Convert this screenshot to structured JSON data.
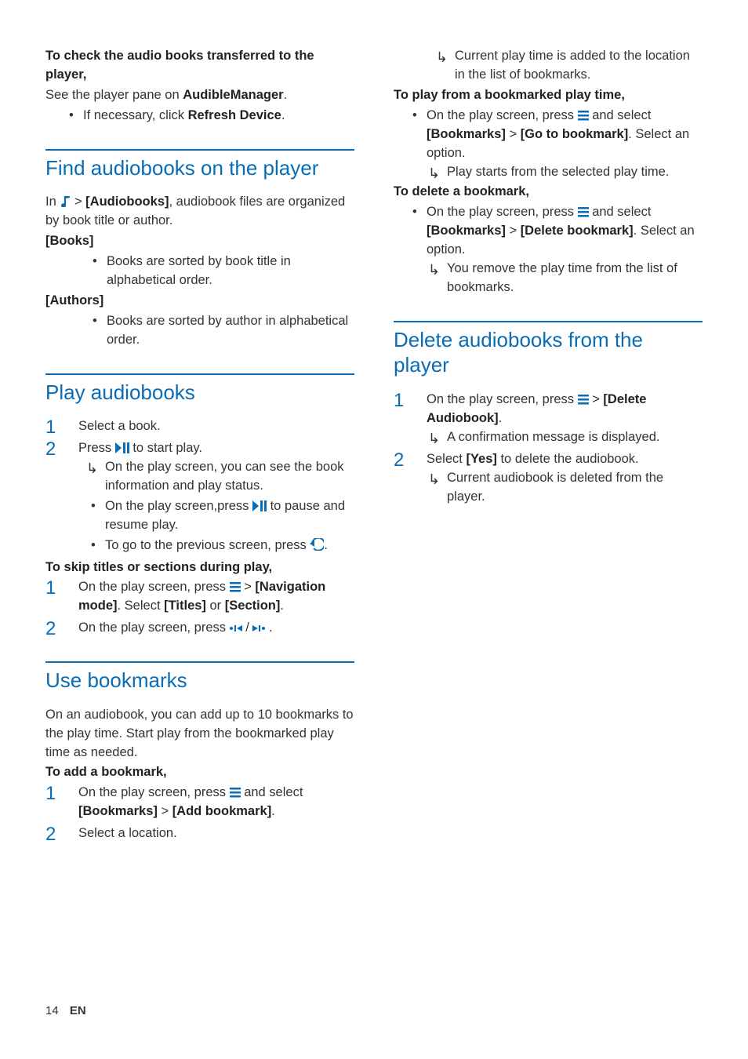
{
  "col1": {
    "check": {
      "heading": "To check the audio books transferred to the player,",
      "line1a": "See the player pane on ",
      "line1b": "AudibleManager",
      "line1c": ".",
      "bullet_a": "If necessary, click ",
      "bullet_b": "Refresh Device",
      "bullet_c": "."
    },
    "find": {
      "title": "Find audiobooks on the player",
      "in_a": "In ",
      "in_b": " > ",
      "in_c": "[Audiobooks]",
      "in_d": ", audiobook files are organized by book title or author.",
      "books_label": "[Books]",
      "books_desc": "Books are sorted by book title in alphabetical order.",
      "authors_label": "[Authors]",
      "authors_desc": "Books are sorted by author in alphabetical order."
    },
    "play": {
      "title": "Play audiobooks",
      "step1": "Select a book.",
      "step2a": "Press ",
      "step2b": " to start play.",
      "step2_arrow": "On the play screen, you can see the book information and play status.",
      "step2_b1a": "On the play screen,press ",
      "step2_b1b": " to pause and resume play.",
      "step2_b2a": "To go to the previous screen, press ",
      "step2_b2b": ".",
      "skip_heading": "To skip titles or sections during play,",
      "skip1a": "On the play screen, press ",
      "skip1b": " > ",
      "skip1c": "[Navigation mode]",
      "skip1d": ". Select ",
      "skip1e": "[Titles]",
      "skip1f": " or ",
      "skip1g": "[Section]",
      "skip1h": ".",
      "skip2a": "On the play screen, press ",
      "skip2b": " / ",
      "skip2c": " ."
    },
    "usebm": {
      "title": "Use bookmarks",
      "intro": "On an audiobook, you can add up to 10 bookmarks to the play time. Start play from the bookmarked play time as needed.",
      "add_heading": "To add a bookmark,",
      "add1a": "On the play screen, press ",
      "add1b": " and select ",
      "add1c": "[Bookmarks]",
      "add1d": " > ",
      "add1e": "[Add bookmark]",
      "add1f": ".",
      "add2": "Select a location."
    }
  },
  "col2": {
    "top_arrow": "Current play time is added to the location in the list of bookmarks.",
    "playfrom_heading": "To play from a bookmarked play time,",
    "playfrom_b_a": "On the play screen, press ",
    "playfrom_b_b": " and select ",
    "playfrom_b_c": "[Bookmarks]",
    "playfrom_b_d": " > ",
    "playfrom_b_e": "[Go to bookmark]",
    "playfrom_b_f": ". Select an option.",
    "playfrom_arrow": "Play starts from the selected play time.",
    "delete_heading": "To delete a bookmark,",
    "delete_b_a": "On the play screen, press ",
    "delete_b_b": " and select ",
    "delete_b_c": "[Bookmarks]",
    "delete_b_d": " > ",
    "delete_b_e": "[Delete bookmark]",
    "delete_b_f": ". Select an option.",
    "delete_arrow": "You remove the play time from the list of bookmarks.",
    "delbooks": {
      "title": "Delete audiobooks from the player",
      "s1a": "On the play screen, press ",
      "s1b": " > ",
      "s1c": "[Delete Audiobook]",
      "s1d": ".",
      "s1_arrow": "A confirmation message is displayed.",
      "s2a": "Select ",
      "s2b": "[Yes]",
      "s2c": " to delete the audiobook.",
      "s2_arrow": "Current audiobook is deleted from the player."
    }
  },
  "footer": {
    "page": "14",
    "lang": "EN"
  }
}
